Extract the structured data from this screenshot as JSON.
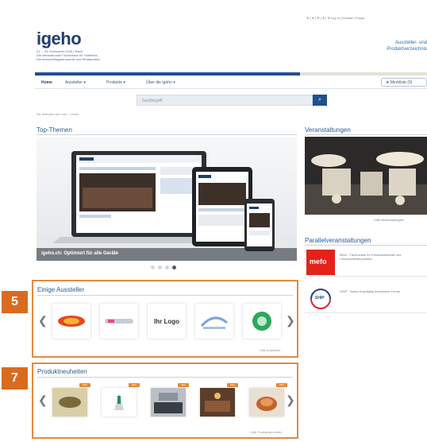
{
  "header": {
    "logo": "igeho",
    "logo_sub": "21. – 25. November 2015 | Basel\nDie internationale Fachmesse für Hotellerie,\nGemeinschaftsgastronomie und Restauration",
    "top_links": "⊕ | ⊕ | ⊕ | ⊕ | ⊕ Log in | Kontakt | Popup",
    "headline": "Aussteller- und\nProduktverzeichnis"
  },
  "nav": {
    "items": [
      "Home",
      "Aussteller ▾",
      "Produkte ▾",
      "Über die Igeho ▾"
    ],
    "merkliste": "★ Merkliste (0)"
  },
  "search": {
    "placeholder": "Suchbegriff",
    "button_icon": "search-icon"
  },
  "breadcrumb": "Sie befinden sich hier: › Home",
  "sections": {
    "top_themen": "Top-Themen",
    "veranstaltungen": "Veranstaltungen",
    "parallelveranstaltungen": "Parallelveranstaltungen"
  },
  "slider": {
    "caption": "igeho.ch: Optimiert für alle Geräte",
    "active_slide": 4,
    "slide_count": 4
  },
  "events": {
    "link": "› Alle Veranstaltungen"
  },
  "parallel": [
    {
      "logo": "mefo",
      "text": "Mefo - Fachmesse für Fleischwirtschaft und Lebensmittelproduktion"
    },
    {
      "logo": "SHIP",
      "text": "SHIP - Swiss Hospitality Investment Forum"
    }
  ],
  "exhibitors": {
    "badge": "5",
    "title": "Einige Aussteller",
    "tiles": [
      "",
      "",
      "Ihr Logo",
      "",
      ""
    ],
    "more": "› Alle Aussteller"
  },
  "products": {
    "badge": "7",
    "title": "Produktneuheiten",
    "neu_label": "NEU",
    "more": "› Alle Produktneuheiten"
  },
  "colors": {
    "accent": "#e28a47",
    "badge": "#d96b1f",
    "brand": "#1f4f8e"
  }
}
